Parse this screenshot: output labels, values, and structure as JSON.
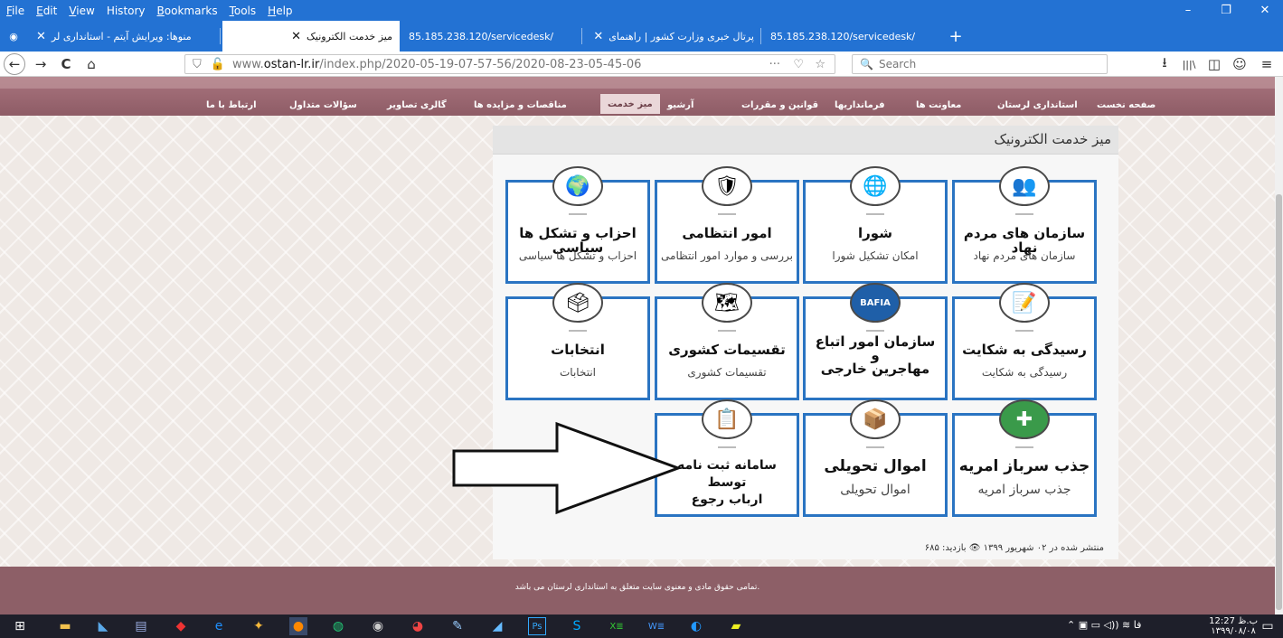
{
  "menubar": {
    "items": [
      {
        "label": "File",
        "u": "F",
        "rest": "ile"
      },
      {
        "label": "Edit",
        "u": "E",
        "rest": "dit"
      },
      {
        "label": "View",
        "u": "V",
        "rest": "iew"
      },
      {
        "label": "History",
        "u": "",
        "rest": "History"
      },
      {
        "label": "Bookmarks",
        "u": "B",
        "rest": "ookmarks"
      },
      {
        "label": "Tools",
        "u": "T",
        "rest": "ools"
      },
      {
        "label": "Help",
        "u": "H",
        "rest": "elp"
      }
    ],
    "minimize": "–",
    "restore": "❐",
    "close": "✕"
  },
  "tabs": [
    {
      "label": "منوها: ویرایش آیتم - استانداری لر",
      "close": "✕",
      "active": false
    },
    {
      "label": "میز خدمت الکترونیک",
      "close": "✕",
      "active": true
    },
    {
      "label": "85.185.238.120/servicedesk/",
      "close": "✕",
      "active": false
    },
    {
      "label": "پرتال خبری وزارت کشور | راهنمای",
      "close": "✕",
      "active": false
    },
    {
      "label": "85.185.238.120/servicedesk/",
      "close": "✕",
      "active": false
    }
  ],
  "newtab": "+",
  "navbar": {
    "back": "←",
    "forward": "→",
    "reload": "C",
    "home": "⌂",
    "url_prefix": "www.",
    "url_host": "ostan-lr.ir",
    "url_path": "/index.php/2020-05-19-07-57-56/2020-08-23-05-45-06",
    "url_more": "···",
    "search_placeholder": "Search",
    "download": "⭳",
    "library": "|||\\",
    "sidebar": "◫",
    "menu": "≡"
  },
  "sitenav": [
    {
      "label": "صفحه نخست",
      "active": false
    },
    {
      "label": "استانداری لرستان",
      "active": false
    },
    {
      "label": "معاونت ها",
      "active": false
    },
    {
      "label": "فرمانداریها",
      "active": false
    },
    {
      "label": "قوانین و مقررات",
      "active": false
    },
    {
      "label": "آرشیو",
      "active": false
    },
    {
      "label": "میز خدمت",
      "active": true
    },
    {
      "label": "مناقصات و مزایده ها",
      "active": false
    },
    {
      "label": "گالری تصاویر",
      "active": false
    },
    {
      "label": "سؤالات متداول",
      "active": false
    },
    {
      "label": "ارتباط با ما",
      "active": false
    }
  ],
  "panel": {
    "title": "میز خدمت الکترونیک",
    "cards": [
      {
        "title": "سازمان های مردم نهاد",
        "subtitle": "سازمان های مردم نهاد",
        "icon": "people-icon",
        "glyph": "👥"
      },
      {
        "title": "شورا",
        "subtitle": "امکان تشکیل شورا",
        "icon": "council-icon",
        "glyph": "🌐"
      },
      {
        "title": "امور انتظامی",
        "subtitle": "بررسی و موارد امور انتظامی",
        "icon": "police-emblem-icon",
        "glyph": "🛡"
      },
      {
        "title": "احزاب و تشکل ها سیاسی",
        "subtitle": "احزاب و تشکل ها سیاسی",
        "icon": "parties-icon",
        "glyph": "🌍"
      },
      {
        "title": "رسیدگی به شکایت",
        "subtitle": "رسیدگی به شکایت",
        "icon": "complaint-icon",
        "glyph": "📝"
      },
      {
        "title": "سازمان امور اتباع\nو\nمهاجرین خارجی",
        "subtitle": "",
        "icon": "bafia-logo-icon",
        "glyph": "BAFIA"
      },
      {
        "title": "تقسیمات کشوری",
        "subtitle": "تقسیمات کشوری",
        "icon": "iran-map-icon",
        "glyph": "🗺"
      },
      {
        "title": "انتخابات",
        "subtitle": "انتخابات",
        "icon": "ballot-box-icon",
        "glyph": "🗳"
      },
      {
        "title": "جذب سرباز امریه",
        "subtitle": "جذب سرباز امریه",
        "icon": "soldier-icon",
        "glyph": "✚"
      },
      {
        "title": "اموال تحویلی",
        "subtitle": "اموال تحویلی",
        "icon": "delivery-box-icon",
        "glyph": "📦"
      },
      {
        "title": "سامانه ثبت نامه توسط\nارباب رجوع",
        "subtitle": "",
        "icon": "letter-form-icon",
        "glyph": "📋"
      }
    ],
    "meta": "منتشر شده در ۰۲ شهریور ۱۳۹۹ 👁 بازدید: ۶۸۵"
  },
  "footer": "تمامی حقوق مادی و معنوی سایت متعلق به استانداری لرستان می باشد.",
  "taskbar": {
    "clock_time": "12:27 ب.ظ",
    "clock_date": "۱۳۹۹/۰۸/۰۸",
    "lang": "فا"
  }
}
